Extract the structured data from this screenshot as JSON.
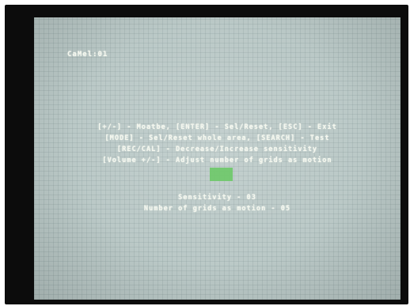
{
  "osd": {
    "camera_title": "CaMel:01",
    "instructions": [
      "[+/-] - Moatbe, [ENTER] - Sel/Reset, [ESC] - Exit",
      "[MODE] - Sel/Reset whole area, [SEARCH] - Test",
      "[REC/CAL] - Decrease/Increase sensitivity",
      "[Volume +/-] - Adjust number of grids as motion"
    ],
    "status": {
      "sensitivity": "Sensitivity - 03",
      "grid_count": "Number of grids as motion - 05"
    }
  },
  "colors": {
    "screen_background": "#b7c6c4",
    "osd_text": "#f4f7ee",
    "grid_cursor": "#6fc96a",
    "bezel": "#0c0c0c"
  }
}
